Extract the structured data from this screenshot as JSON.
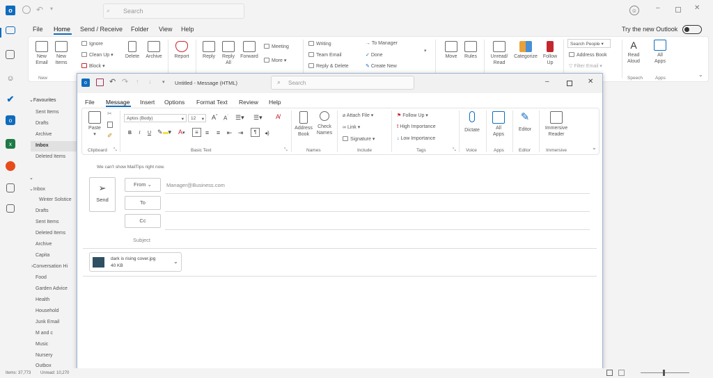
{
  "topbar": {
    "search_placeholder": "Search",
    "try_new_outlook": "Try the new Outlook"
  },
  "main_menu": [
    "File",
    "Home",
    "Send / Receive",
    "Folder",
    "View",
    "Help"
  ],
  "main_ribbon": {
    "new_email": [
      "New",
      "Email"
    ],
    "new_items": [
      "New",
      "Items"
    ],
    "ignore": "Ignore",
    "clean_up": "Clean Up",
    "block": "Block",
    "new_group_label": "New",
    "delete": "Delete",
    "archive": "Archive",
    "report": "Report",
    "reply": "Reply",
    "reply_all": [
      "Reply",
      "All"
    ],
    "forward": "Forward",
    "meeting": "Meeting",
    "more": "More",
    "qs_writing": "Writing",
    "qs_team_email": "Team Email",
    "qs_reply_delete": "Reply & Delete",
    "qs_to_manager": "To Manager",
    "qs_done": "Done",
    "qs_create_new": "Create New",
    "move": "Move",
    "rules": "Rules",
    "unread_read": [
      "Unread/",
      "Read"
    ],
    "categorize": "Categorize",
    "follow_up": [
      "Follow",
      "Up"
    ],
    "search_people": "Search People",
    "address_book": "Address Book",
    "filter_email": "Filter Email",
    "read_aloud": [
      "Read",
      "Aloud"
    ],
    "all_apps": [
      "All",
      "Apps"
    ],
    "speech_label": "Speech",
    "apps_label": "Apps"
  },
  "folders": {
    "favourites": "Favourites",
    "fav_items": [
      "Sent Items",
      "Drafts",
      "Archive",
      "Inbox",
      "Deleted Items"
    ],
    "inbox": "Inbox",
    "items": [
      "Winter Solstice",
      "Drafts",
      "Sent Items",
      "Deleted Items",
      "Archive",
      "Capita",
      "Conversation Hi",
      "Food",
      "Garden Advice",
      "Health",
      "Household",
      "Junk Email",
      "M and c",
      "Music",
      "Nursery",
      "Outbox"
    ]
  },
  "compose": {
    "title": "Untitled - Message (HTML)",
    "search_placeholder": "Search",
    "tabs": [
      "File",
      "Message",
      "Insert",
      "Options",
      "Format Text",
      "Review",
      "Help"
    ],
    "paste": "Paste",
    "font_name": "Aptos (Body)",
    "font_size": "12",
    "address_book": [
      "Address",
      "Book"
    ],
    "check_names": [
      "Check",
      "Names"
    ],
    "attach_file": "Attach File",
    "link": "Link",
    "signature": "Signature",
    "follow_up": "Follow Up",
    "high_importance": "High Importance",
    "low_importance": "Low Importance",
    "dictate": "Dictate",
    "all_apps": [
      "All",
      "Apps"
    ],
    "editor": "Editor",
    "immersive_reader": [
      "Immersive",
      "Reader"
    ],
    "groups": [
      "Clipboard",
      "Basic Text",
      "Names",
      "Include",
      "Tags",
      "Voice",
      "Apps",
      "Editor",
      "Immersive"
    ],
    "mailtips": "We can't show MailTips right now.",
    "send": "Send",
    "from": "From",
    "from_value": "Manager@Business.com",
    "to": "To",
    "cc": "Cc",
    "subject": "Subject",
    "attachment_name": "dark is rising cover.jpg",
    "attachment_size": "40 KB"
  },
  "status": {
    "items": "Items: 37,773",
    "unread": "Unread: 10,270"
  },
  "colors": {
    "outlook_blue": "#0f6cbd",
    "follow_red": "#c4262e",
    "compose_border": "#9cb6d6"
  }
}
